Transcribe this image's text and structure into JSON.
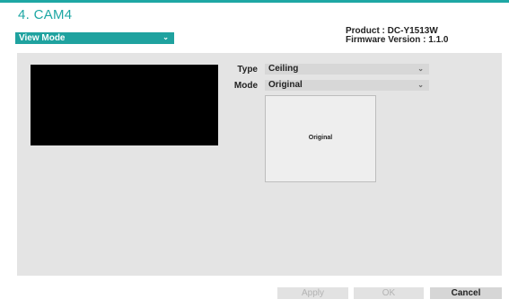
{
  "header": {
    "title": "4. CAM4"
  },
  "view_mode_select": {
    "value": "View Mode",
    "caret": "⌄"
  },
  "device_info": {
    "product_line": "Product : DC-Y1513W",
    "firmware_line": "Firmware Version : 1.1.0"
  },
  "settings": {
    "type_label": "Type",
    "type_value": "Ceiling",
    "mode_label": "Mode",
    "mode_value": "Original",
    "caret": "⌄"
  },
  "preview": {
    "thumbnail_label": "Original"
  },
  "buttons": {
    "apply": "Apply",
    "ok": "OK",
    "cancel": "Cancel"
  },
  "colors": {
    "accent": "#1ea7a4",
    "panel_bg": "#e4e4e4"
  }
}
